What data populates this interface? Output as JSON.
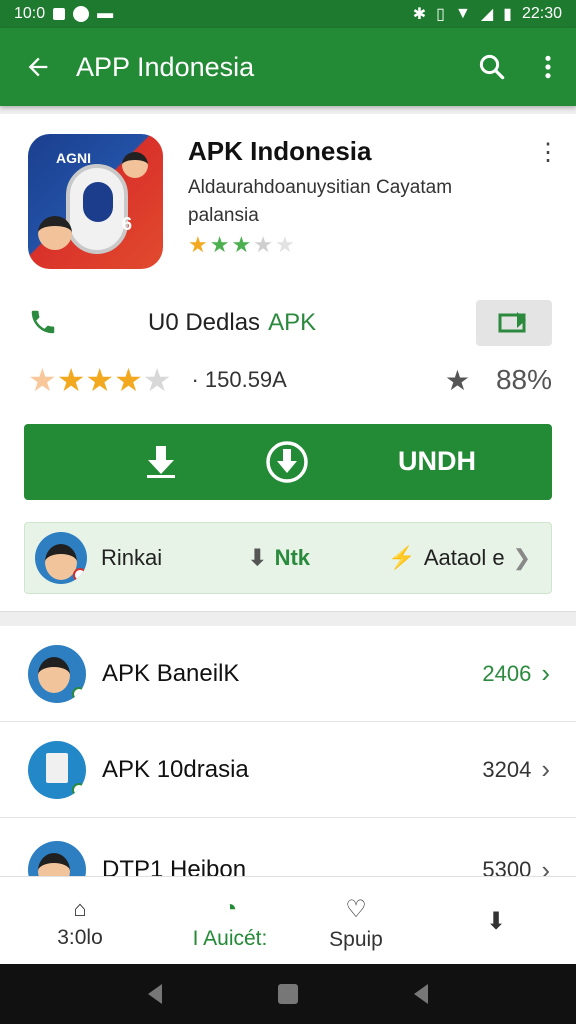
{
  "status_bar": {
    "time_left": "10:0",
    "time_right": "22:30"
  },
  "appbar": {
    "title": "APP Indonesia"
  },
  "app": {
    "name": "APK Indonesia",
    "description": "Aldaurahdoanuysitian Cayatam palansia",
    "icon_label": "AGNI",
    "icon_letter": "6",
    "stars": [
      "★",
      "★",
      "★",
      "★",
      "★"
    ]
  },
  "download_row": {
    "label": "U0 Dedlas",
    "apk": "APK"
  },
  "rating_row": {
    "count": "· 150.59A",
    "right_value": "88%"
  },
  "install": {
    "label": "UNDH"
  },
  "info_row": {
    "name": "Rinkai",
    "mid": "Ntk",
    "right": "Aataol e"
  },
  "list": [
    {
      "name": "APK BaneilK",
      "value": "2406",
      "value_color": "#2b8a3e"
    },
    {
      "name": "APK 10drasia",
      "name_prefix_color": "#c62828",
      "value": "3204"
    },
    {
      "name": "DTP1 Heibon",
      "value": "5300"
    }
  ],
  "bottom_nav": [
    {
      "label": "3:0lo"
    },
    {
      "label": "I Auicét:"
    },
    {
      "label": "Spuip"
    },
    {
      "label": ""
    }
  ],
  "colors": {
    "primary": "#238a36",
    "primary_dark": "#1e7a2e",
    "star": "#f2a91f",
    "star_green": "#4caf50"
  }
}
